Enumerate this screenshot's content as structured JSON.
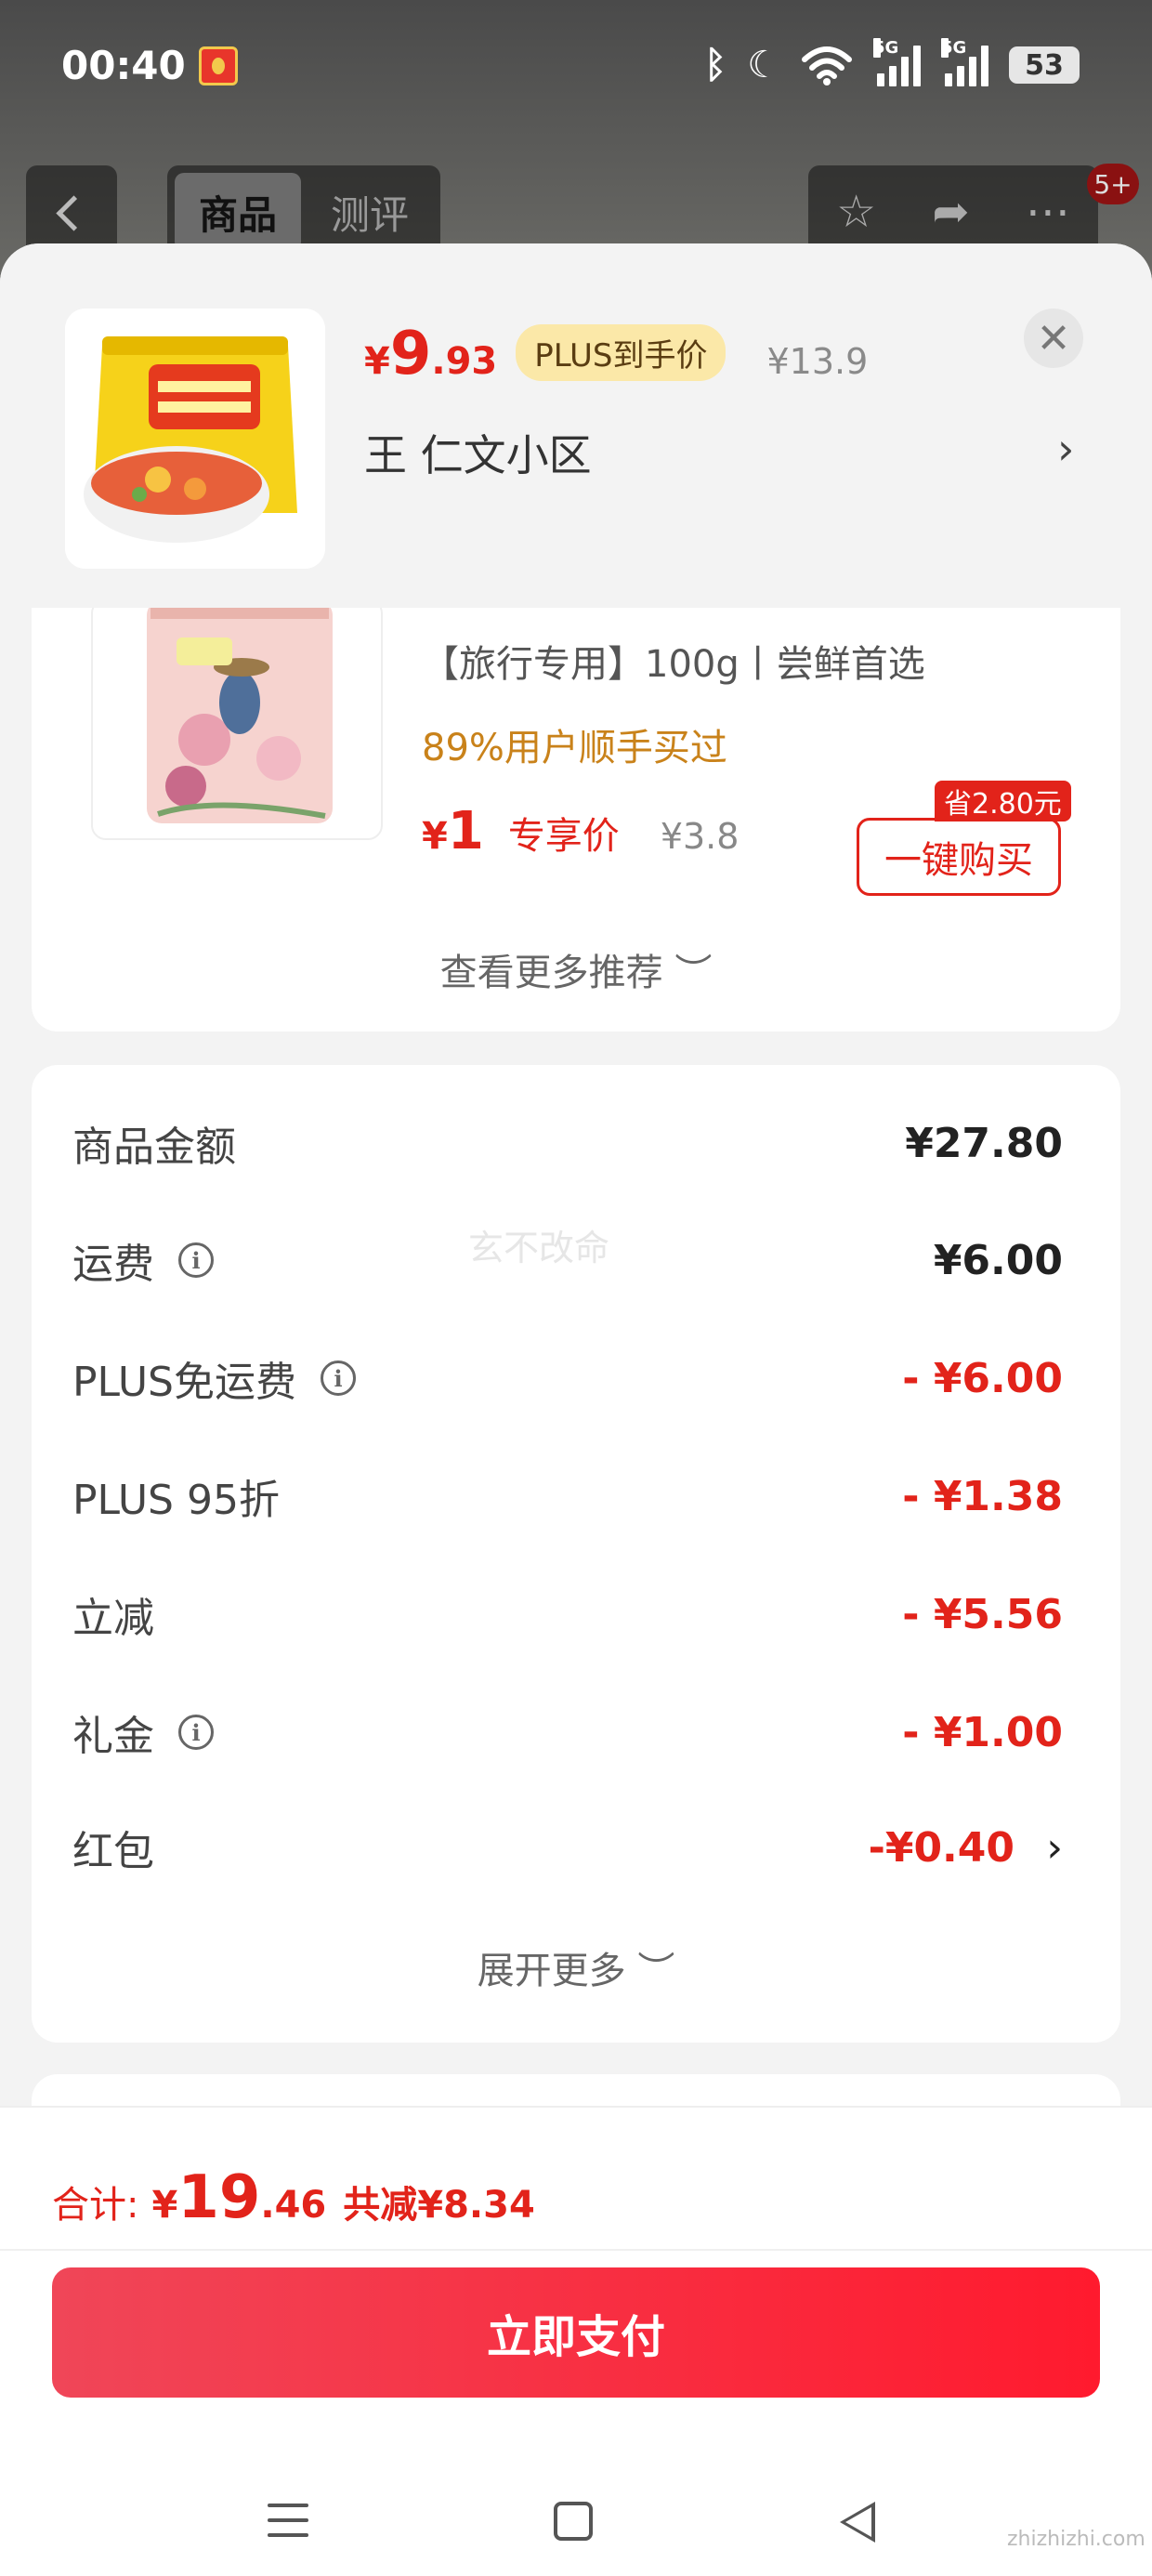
{
  "status_bar": {
    "time": "00:40",
    "network_1": "5G",
    "network_2": "5G",
    "battery": "53"
  },
  "nav": {
    "tabs": [
      {
        "label": "商品",
        "active": true
      },
      {
        "label": "测评",
        "active": false
      }
    ],
    "cart_badge": "5+"
  },
  "header": {
    "price_symbol": "¥",
    "price_int": "9",
    "price_dec": ".93",
    "plus_tag": "PLUS到手价",
    "original_price": "¥13.9",
    "close_glyph": "✕",
    "address": "王  仁文小区",
    "chevron": "›"
  },
  "recommendation": {
    "title": "【旅行专用】100g丨尝鲜首选",
    "stat": "89%用户顺手买过",
    "price_symbol": "¥",
    "price": "1",
    "price_label": "专享价",
    "original_price": "¥3.8",
    "save_tag": "省2.80元",
    "buy_label": "一键购买",
    "see_more": "查看更多推荐 ︶"
  },
  "summary": {
    "watermark": "玄不改命",
    "rows": [
      {
        "label": "商品金额",
        "value": "¥27.80",
        "info": false
      },
      {
        "label": "运费",
        "value": "¥6.00",
        "info": true
      },
      {
        "label": "PLUS免运费",
        "value": "- ¥6.00",
        "info": true
      },
      {
        "label": "PLUS 95折",
        "value": "- ¥1.38",
        "info": false
      },
      {
        "label": "立减",
        "value": "- ¥5.56",
        "info": false
      },
      {
        "label": "礼金",
        "value": "- ¥1.00",
        "info": true
      },
      {
        "label": "红包",
        "value": "-¥0.40",
        "info": false
      }
    ],
    "info_glyph": "i",
    "row_chevron": "›",
    "expand_more": "展开更多 ︶"
  },
  "footer": {
    "total_label": "合计:",
    "total_symbol": "¥",
    "total_int": "19",
    "total_dec": ".46",
    "total_discount": "共减¥8.34",
    "pay_button": "立即支付"
  },
  "site_mark": "zhizhizhi.com",
  "colors": {
    "accent_red": "#e2231a",
    "plus_gold": "#fbe8a8",
    "stat_orange": "#c9821a"
  }
}
